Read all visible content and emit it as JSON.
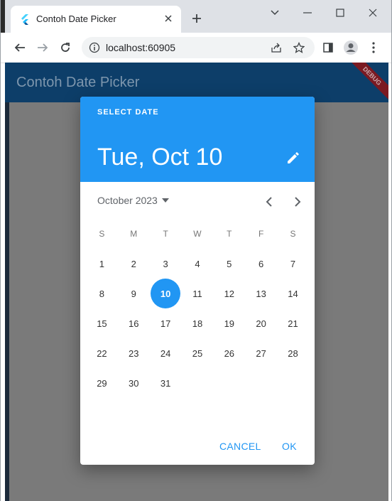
{
  "browser": {
    "tab_title": "Contoh Date Picker",
    "url": "localhost:60905"
  },
  "app": {
    "title": "Contoh Date Picker",
    "debug_banner": "DEBUG",
    "colors": {
      "appbar": "#0d3e69",
      "accent": "#2196f3"
    }
  },
  "dialog": {
    "help_text": "SELECT DATE",
    "selected_date": "Tue, Oct 10",
    "month_label": "October 2023",
    "weekdays": [
      "S",
      "M",
      "T",
      "W",
      "T",
      "F",
      "S"
    ],
    "weeks": [
      [
        "1",
        "2",
        "3",
        "4",
        "5",
        "6",
        "7"
      ],
      [
        "8",
        "9",
        "10",
        "11",
        "12",
        "13",
        "14"
      ],
      [
        "15",
        "16",
        "17",
        "18",
        "19",
        "20",
        "21"
      ],
      [
        "22",
        "23",
        "24",
        "25",
        "26",
        "27",
        "28"
      ],
      [
        "29",
        "30",
        "31",
        "",
        "",
        "",
        ""
      ]
    ],
    "selected_day": "10",
    "cancel_label": "CANCEL",
    "ok_label": "OK"
  }
}
